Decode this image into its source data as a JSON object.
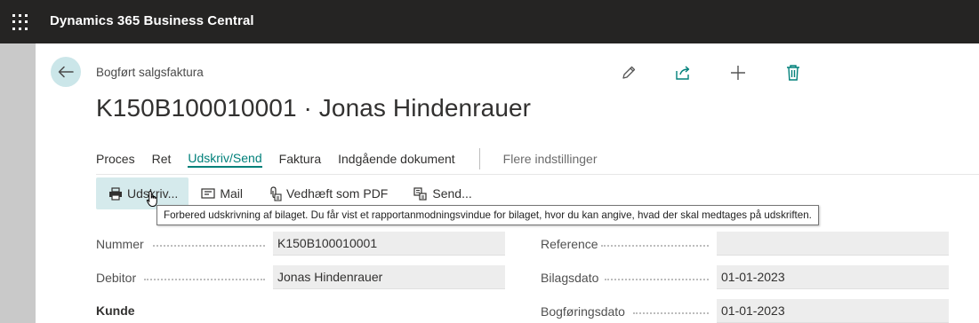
{
  "app": {
    "title": "Dynamics 365 Business Central"
  },
  "page": {
    "breadcrumb": "Bogført salgsfaktura",
    "title": "K150B100010001 · Jonas Hindenrauer"
  },
  "actions": [
    "edit-icon",
    "share-icon",
    "add-icon",
    "delete-icon"
  ],
  "nav": {
    "items": [
      "Proces",
      "Ret",
      "Udskriv/Send",
      "Faktura",
      "Indgående dokument"
    ],
    "active": "Udskriv/Send",
    "more": "Flere indstillinger"
  },
  "subbar": {
    "items": [
      {
        "label": "Udskriv...",
        "icon": "printer-icon"
      },
      {
        "label": "Mail",
        "icon": "mail-icon"
      },
      {
        "label": "Vedhæft som PDF",
        "icon": "attach-pdf-icon"
      },
      {
        "label": "Send...",
        "icon": "send-icon"
      }
    ]
  },
  "tooltip": {
    "text": "Forbered udskrivning af bilaget. Du får vist et rapportanmodningsvindue for bilaget, hvor du kan angive, hvad der skal medtages på udskriften."
  },
  "fields": {
    "nummer": {
      "label": "Nummer",
      "value": "K150B100010001"
    },
    "debitor": {
      "label": "Debitor",
      "value": "Jonas Hindenrauer"
    },
    "reference": {
      "label": "Reference",
      "value": ""
    },
    "bilagsdato": {
      "label": "Bilagsdato",
      "value": "01-01-2023"
    },
    "bogforingsdato": {
      "label": "Bogføringsdato",
      "value": "01-01-2023"
    }
  },
  "sections": {
    "kunde": "Kunde"
  },
  "colors": {
    "topbar": "#252423",
    "accent": "#00807a",
    "back_button": "#cbe6e9",
    "hover": "#d5eaec"
  }
}
